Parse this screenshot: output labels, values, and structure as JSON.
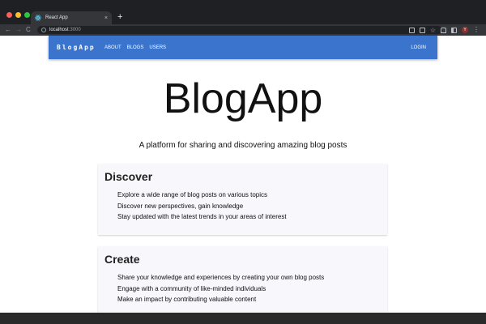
{
  "browser": {
    "tab_title": "React App",
    "tab_close": "×",
    "new_tab": "+",
    "url_host": "localhost",
    "url_port": ":3000",
    "back": "←",
    "forward": "→",
    "reload": "C",
    "profile_initial": "Y",
    "menu": "⋮"
  },
  "appbar": {
    "brand": "BlogApp",
    "nav": [
      "ABOUT",
      "BLOGS",
      "USERS"
    ],
    "login": "LOGIN",
    "color": "#3a74cd"
  },
  "hero": {
    "title": "BlogApp",
    "tagline": "A platform for sharing and discovering amazing blog posts"
  },
  "sections": [
    {
      "title": "Discover",
      "items": [
        "Explore a wide range of blog posts on various topics",
        "Discover new perspectives, gain knowledge",
        "Stay updated with the latest trends in your areas of interest"
      ]
    },
    {
      "title": "Create",
      "items": [
        "Share your knowledge and experiences by creating your own blog posts",
        "Engage with a community of like-minded individuals",
        "Make an impact by contributing valuable content"
      ]
    }
  ]
}
